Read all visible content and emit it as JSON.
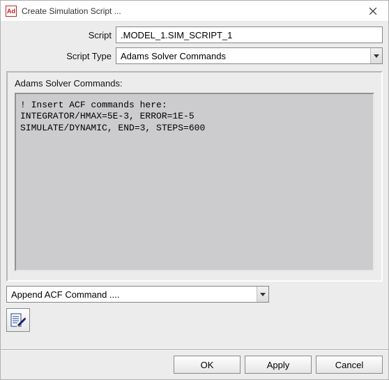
{
  "window": {
    "app_icon_text": "Ad",
    "title": "Create Simulation Script ..."
  },
  "form": {
    "script_label": "Script",
    "script_value": ".MODEL_1.SIM_SCRIPT_1",
    "script_type_label": "Script Type",
    "script_type_value": "Adams Solver Commands"
  },
  "group": {
    "label": "Adams Solver Commands:",
    "code": "! Insert ACF commands here:\nINTEGRATOR/HMAX=5E-3, ERROR=1E-5\nSIMULATE/DYNAMIC, END=3, STEPS=600"
  },
  "append_select": {
    "value": "Append ACF Command ...."
  },
  "footer": {
    "ok": "OK",
    "apply": "Apply",
    "cancel": "Cancel"
  }
}
